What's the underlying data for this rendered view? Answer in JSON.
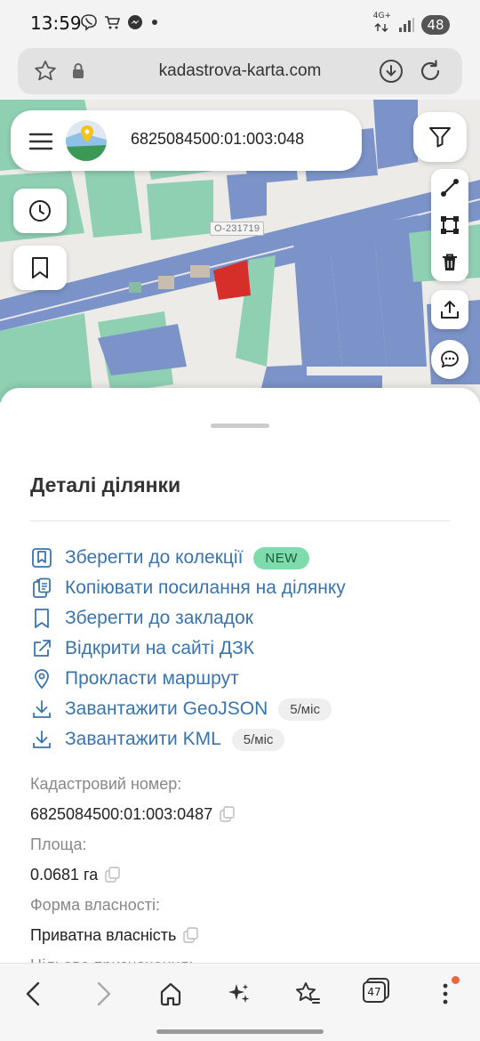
{
  "status_bar": {
    "time": "13:59",
    "network": "4G+",
    "battery": "48"
  },
  "browser": {
    "url": "kadastrova-karta.com"
  },
  "map": {
    "search_value": "6825084500:01:003:048",
    "road_label": "O-231719",
    "colors": {
      "parcel_blue": "#7b93c8",
      "parcel_green": "#8fcfb2",
      "selected": "#d62f2a",
      "background": "#ecebe8"
    }
  },
  "sheet": {
    "title": "Деталі ділянки",
    "actions": [
      {
        "icon": "bookmark-collection-icon",
        "label": "Зберегти до колекції",
        "badge": "NEW"
      },
      {
        "icon": "copy-link-icon",
        "label": "Копіювати посилання на ділянку"
      },
      {
        "icon": "bookmark-icon",
        "label": "Зберегти до закладок"
      },
      {
        "icon": "external-link-icon",
        "label": "Відкрити на сайті ДЗК"
      },
      {
        "icon": "location-pin-icon",
        "label": "Прокласти маршрут"
      },
      {
        "icon": "download-icon",
        "label": "Завантажити GeoJSON",
        "badge": "5/міс"
      },
      {
        "icon": "download-icon",
        "label": "Завантажити KML",
        "badge": "5/міс"
      }
    ],
    "fields": [
      {
        "label": "Кадастровий номер:",
        "value": "6825084500:01:003:0487"
      },
      {
        "label": "Площа:",
        "value": "0.0681 га"
      },
      {
        "label": "Форма власності:",
        "value": "Приватна власність"
      },
      {
        "label": "Цільове призначення:"
      }
    ]
  },
  "bottom_nav": {
    "tab_count": "47"
  }
}
